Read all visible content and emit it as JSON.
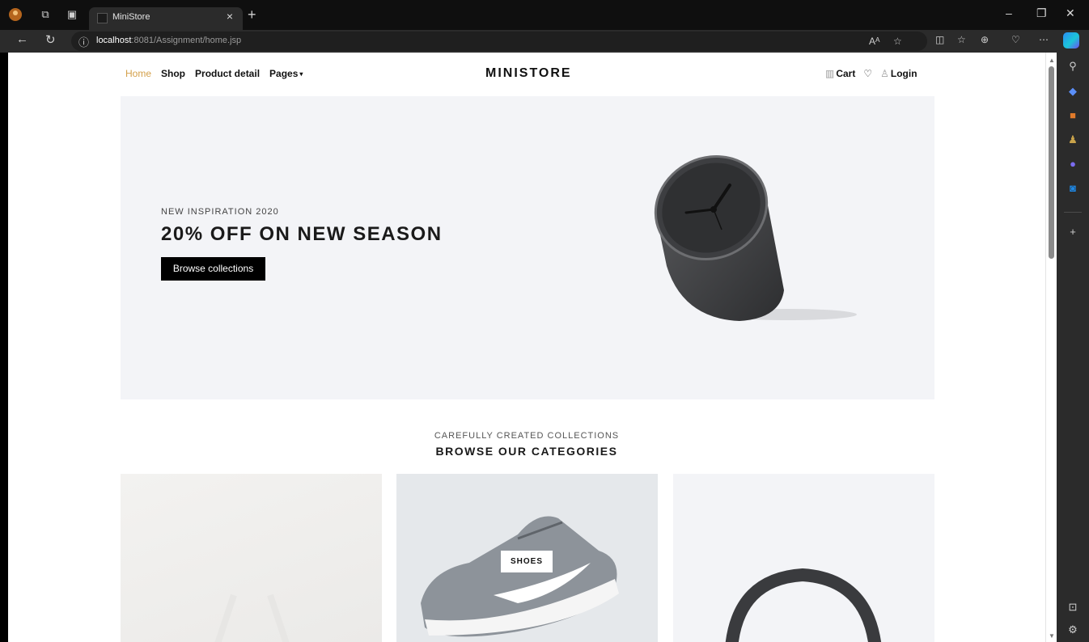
{
  "browser": {
    "tab_title": "MiniStore",
    "tab_close": "×",
    "new_tab": "+",
    "url_host": "localhost",
    "url_rest": ":8081/Assignment/home.jsp",
    "window_controls": [
      "–",
      "❐",
      "✕"
    ]
  },
  "site": {
    "nav": {
      "home": "Home",
      "shop": "Shop",
      "product_detail": "Product detail",
      "pages": "Pages"
    },
    "brand": "MINISTORE",
    "header_right": {
      "cart": "Cart",
      "login": "Login"
    }
  },
  "hero": {
    "eyebrow": "NEW INSPIRATION 2020",
    "title": "20% OFF ON NEW SEASON",
    "button": "Browse collections"
  },
  "categories": {
    "eyebrow": "CAREFULLY CREATED COLLECTIONS",
    "title": "BROWSE OUR CATEGORIES",
    "cards": [
      {
        "label": ""
      },
      {
        "label": "SHOES"
      },
      {
        "label": ""
      }
    ]
  },
  "colors": {
    "accent": "#d4a04a",
    "hero_bg": "#f3f4f7",
    "button_bg": "#000000"
  },
  "icons": [
    "back-icon",
    "refresh-icon",
    "info-icon",
    "read-aloud-icon",
    "favorite-star-icon",
    "split-screen-icon",
    "favorites-icon",
    "collections-icon",
    "health-icon",
    "more-icon",
    "copilot-icon",
    "cart-icon",
    "heart-icon",
    "user-icon"
  ]
}
